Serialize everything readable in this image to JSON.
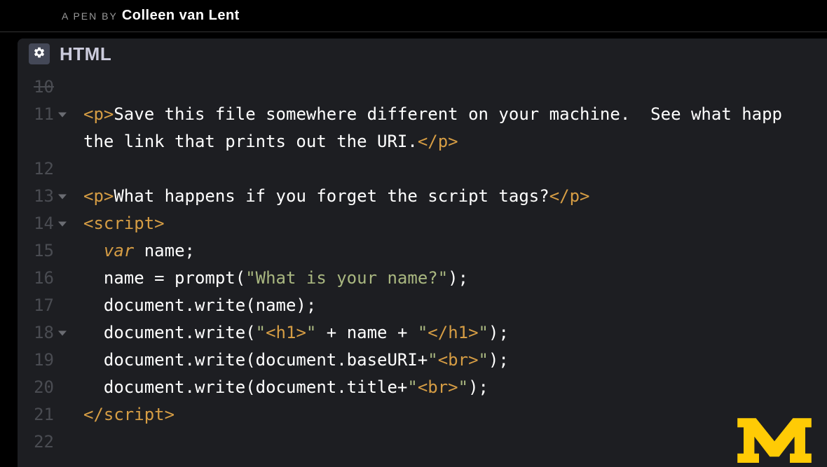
{
  "header": {
    "pen_by": "A PEN BY",
    "author": "Colleen van Lent"
  },
  "panel": {
    "title": "HTML"
  },
  "lines": [
    {
      "num": "10",
      "strike": true,
      "fold": false,
      "tokens": []
    },
    {
      "num": "11",
      "strike": false,
      "fold": true,
      "tokens": [
        {
          "cls": "tag",
          "t": "<p>"
        },
        {
          "cls": "plain",
          "t": "Save this file somewhere different on your machine.  See what happ"
        }
      ]
    },
    {
      "num": "",
      "strike": false,
      "fold": false,
      "tokens": [
        {
          "cls": "plain",
          "t": "the link that prints out the URI."
        },
        {
          "cls": "tag",
          "t": "</p>"
        }
      ]
    },
    {
      "num": "12",
      "strike": false,
      "fold": false,
      "tokens": []
    },
    {
      "num": "13",
      "strike": false,
      "fold": true,
      "tokens": [
        {
          "cls": "tag",
          "t": "<p>"
        },
        {
          "cls": "plain",
          "t": "What happens if you forget the script tags?"
        },
        {
          "cls": "tag",
          "t": "</p>"
        }
      ]
    },
    {
      "num": "14",
      "strike": false,
      "fold": true,
      "tokens": [
        {
          "cls": "tag",
          "t": "<script>"
        }
      ]
    },
    {
      "num": "15",
      "strike": false,
      "fold": false,
      "tokens": [
        {
          "cls": "plain",
          "t": "  "
        },
        {
          "cls": "keyword",
          "t": "var"
        },
        {
          "cls": "plain",
          "t": " name;"
        }
      ]
    },
    {
      "num": "16",
      "strike": false,
      "fold": false,
      "tokens": [
        {
          "cls": "plain",
          "t": "  name = prompt("
        },
        {
          "cls": "string",
          "t": "\"What is your name?\""
        },
        {
          "cls": "plain",
          "t": ");"
        }
      ]
    },
    {
      "num": "17",
      "strike": false,
      "fold": false,
      "tokens": [
        {
          "cls": "plain",
          "t": "  document.write(name);"
        }
      ]
    },
    {
      "num": "18",
      "strike": false,
      "fold": true,
      "tokens": [
        {
          "cls": "plain",
          "t": "  document.write("
        },
        {
          "cls": "string",
          "t": "\""
        },
        {
          "cls": "tag",
          "t": "<h1>"
        },
        {
          "cls": "string",
          "t": "\""
        },
        {
          "cls": "plain",
          "t": " + name + "
        },
        {
          "cls": "string",
          "t": "\""
        },
        {
          "cls": "tag",
          "t": "</h1>"
        },
        {
          "cls": "string",
          "t": "\""
        },
        {
          "cls": "plain",
          "t": ");"
        }
      ]
    },
    {
      "num": "19",
      "strike": false,
      "fold": false,
      "tokens": [
        {
          "cls": "plain",
          "t": "  document.write(document.baseURI+"
        },
        {
          "cls": "string",
          "t": "\""
        },
        {
          "cls": "tag",
          "t": "<br>"
        },
        {
          "cls": "string",
          "t": "\""
        },
        {
          "cls": "plain",
          "t": ");"
        }
      ]
    },
    {
      "num": "20",
      "strike": false,
      "fold": false,
      "tokens": [
        {
          "cls": "plain",
          "t": "  document.write(document.title+"
        },
        {
          "cls": "string",
          "t": "\""
        },
        {
          "cls": "tag",
          "t": "<br>"
        },
        {
          "cls": "string",
          "t": "\""
        },
        {
          "cls": "plain",
          "t": ");"
        }
      ]
    },
    {
      "num": "21",
      "strike": false,
      "fold": false,
      "tokens": [
        {
          "cls": "tag",
          "t": "</script>"
        }
      ]
    },
    {
      "num": "22",
      "strike": false,
      "fold": false,
      "tokens": []
    }
  ]
}
